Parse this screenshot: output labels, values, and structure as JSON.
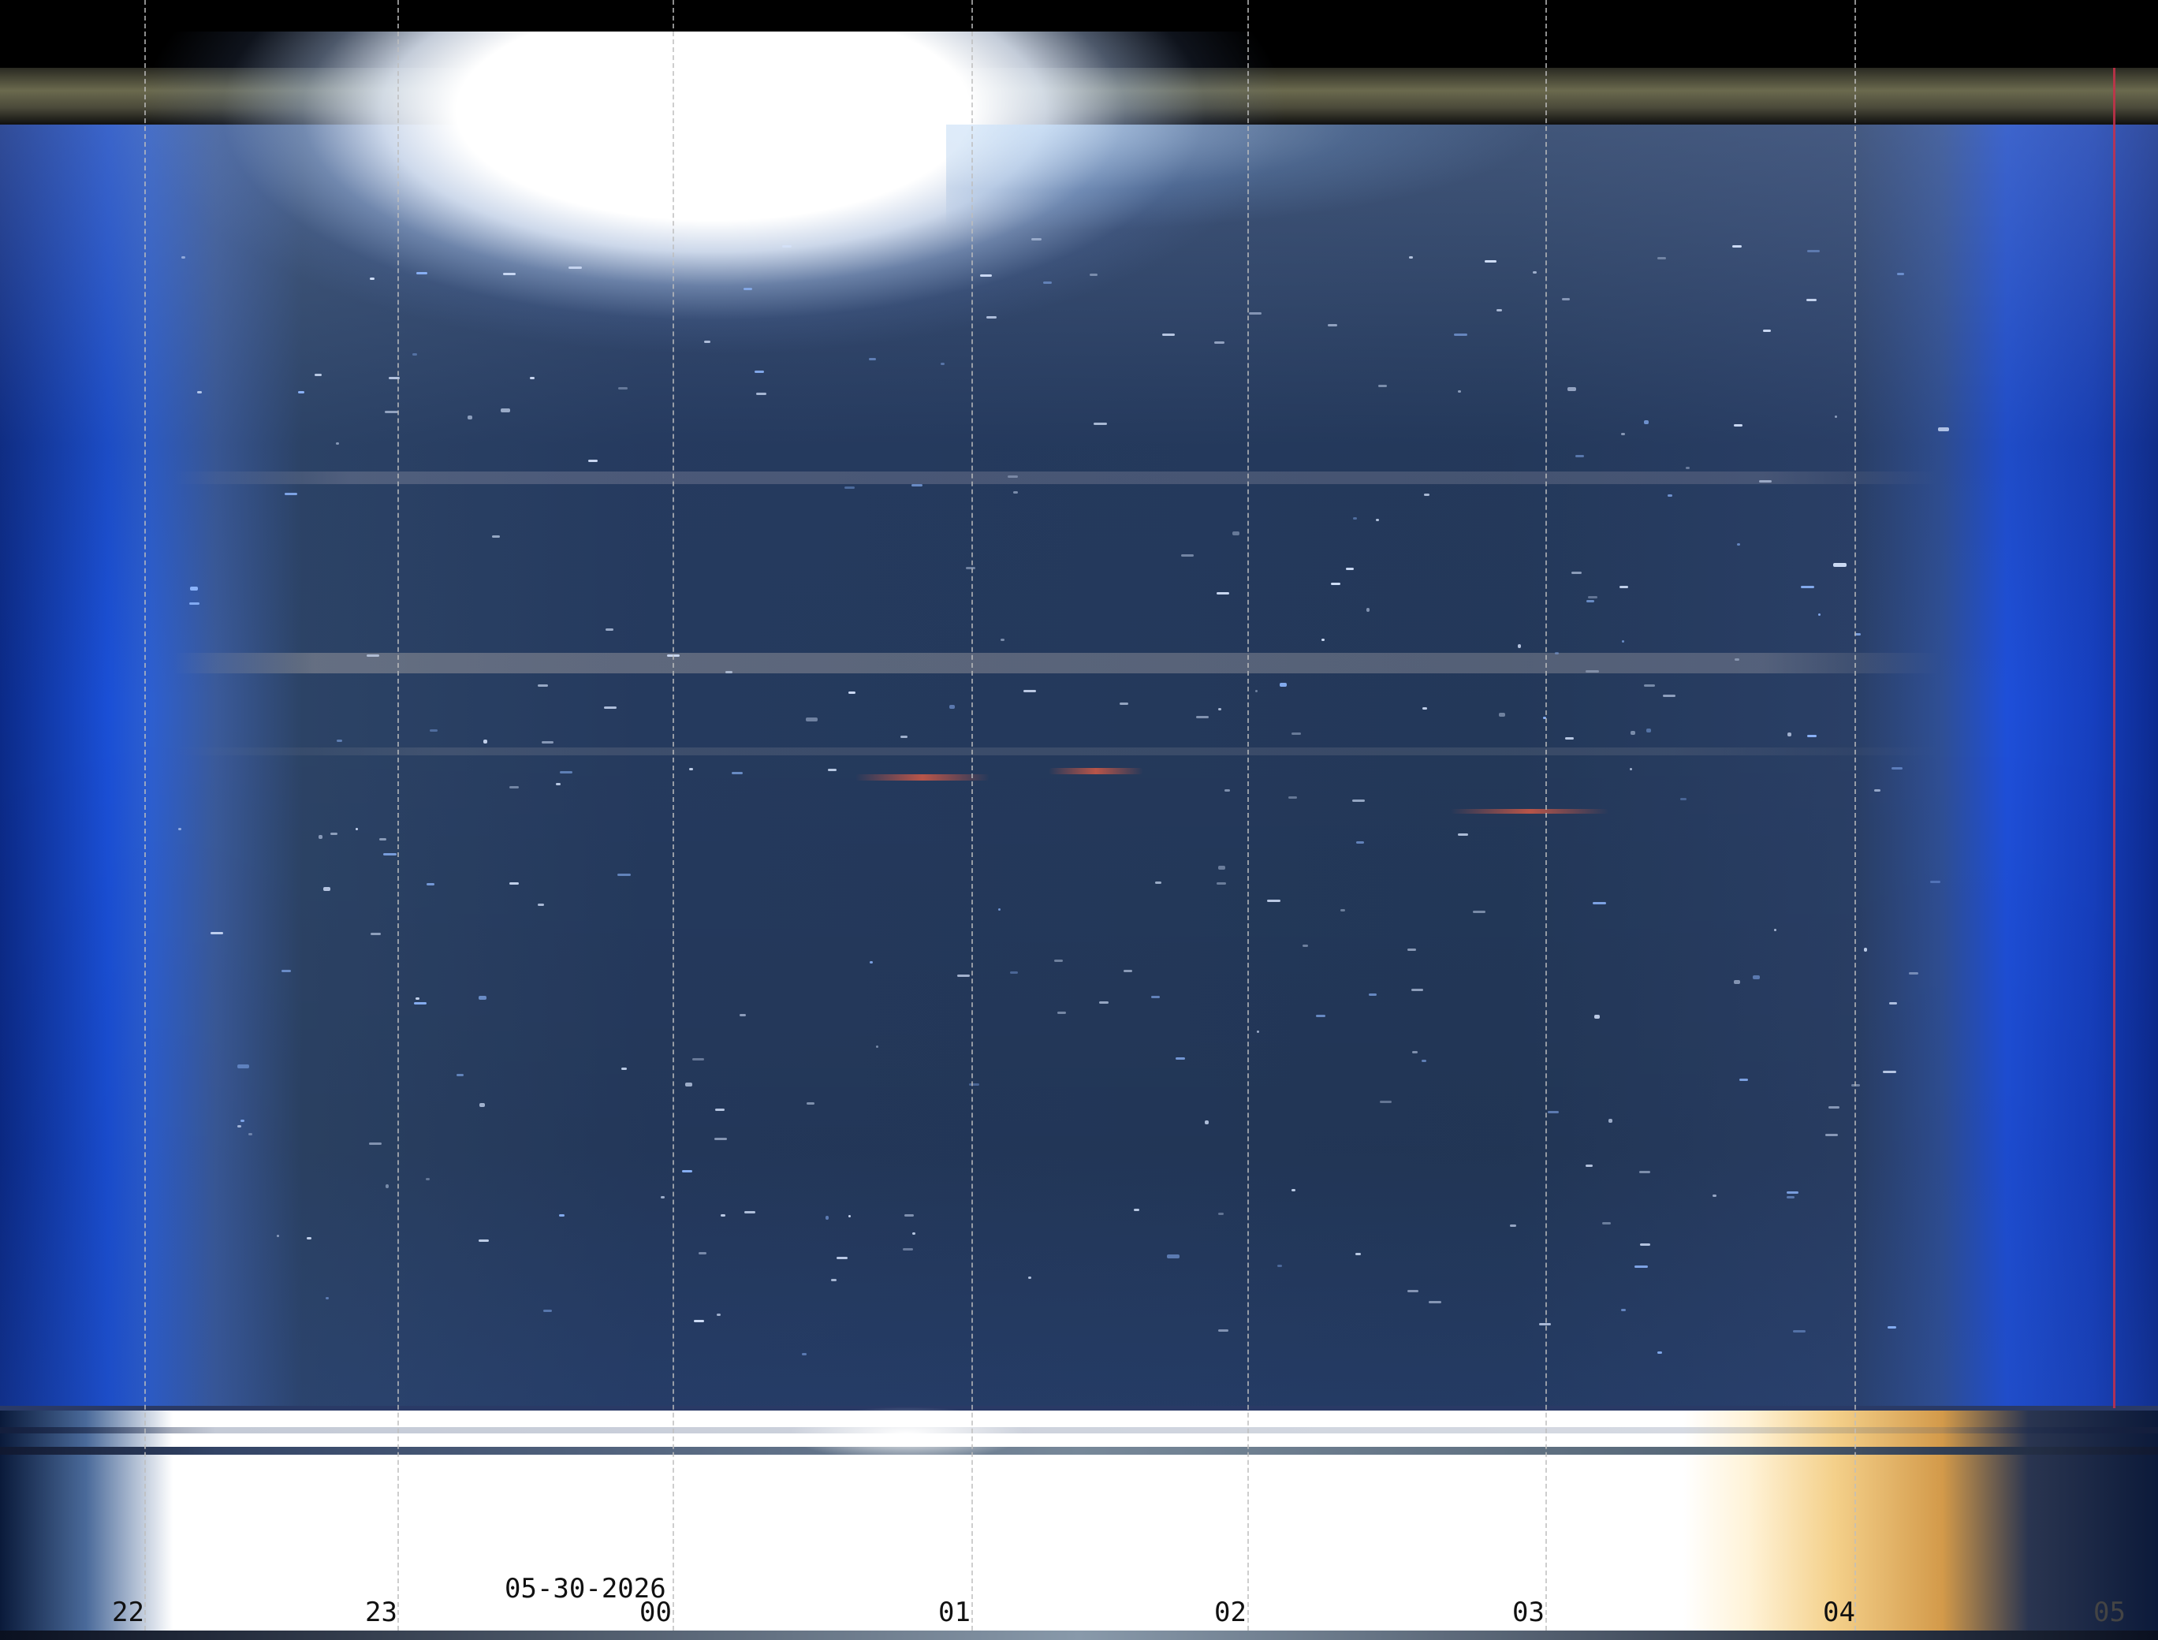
{
  "image": {
    "kind": "all-sky camera keogram",
    "date": "05-30-2026",
    "hour_ticks": [
      "22",
      "23",
      "00",
      "01",
      "02",
      "03",
      "04",
      "05"
    ]
  },
  "colors": {
    "sky_deep": "#233859",
    "twilight_blue": "#1a4fd6",
    "sun_glare": "#ffffff",
    "dawn_gold": "#f4d08a",
    "grid_line": "#bebebe",
    "marker_red": "#c8304a"
  }
}
